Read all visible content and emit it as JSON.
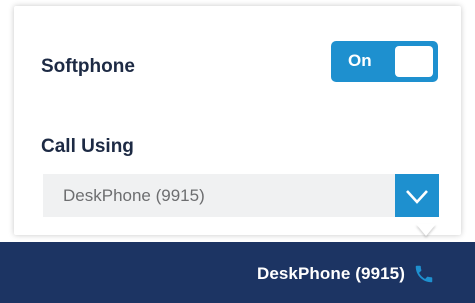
{
  "softphone": {
    "label": "Softphone",
    "toggle_label": "On",
    "toggle_state": "on"
  },
  "call_using": {
    "label": "Call Using",
    "selected": "DeskPhone (9915)"
  },
  "status_bar": {
    "label": "DeskPhone (9915)",
    "icon": "phone-icon"
  },
  "colors": {
    "accent": "#1e90cf",
    "bar": "#1c3463",
    "text": "#1d2a44"
  }
}
